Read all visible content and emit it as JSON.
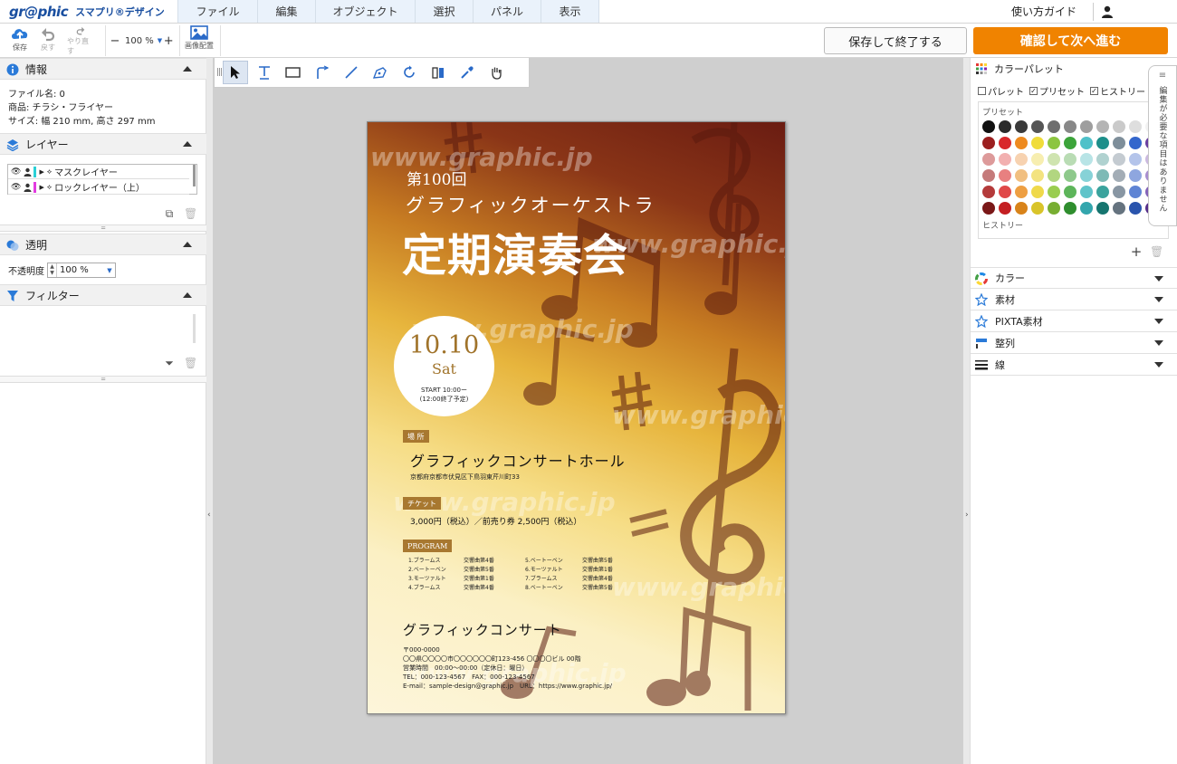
{
  "app": {
    "brand": "gr@phic",
    "app_name": "スマプリ®デザイン"
  },
  "menu": {
    "items": [
      "ファイル",
      "編集",
      "オブジェクト",
      "選択",
      "パネル",
      "表示"
    ],
    "guide": "使い方ガイド"
  },
  "toolbar": {
    "save": "保存",
    "undo": "戻す",
    "redo": "やり直す",
    "zoom_value": "100 %",
    "zoom_minus": "−",
    "zoom_plus": "+",
    "image_place": "画像配置",
    "save_exit": "保存して終了する",
    "confirm_next": "確認して次へ進む"
  },
  "left_panel": {
    "info": {
      "title": "情報",
      "file_name": "ファイル名:  0",
      "product": "商品:  チラシ・フライヤー",
      "size": "サイズ:  幅 210 mm,  高さ 297 mm"
    },
    "layers": {
      "title": "レイヤー",
      "items": [
        {
          "name": "マスクレイヤー",
          "color": "#2bd0d6"
        },
        {
          "name": "ロックレイヤー（上）",
          "color": "#e23be0"
        }
      ]
    },
    "transparency": {
      "title": "透明",
      "label": "不透明度",
      "value": "100 %"
    },
    "filter": {
      "title": "フィルター"
    }
  },
  "flyer": {
    "watermark": "www.graphic.jp",
    "edition": "第100回",
    "subtitle": "グラフィックオーケストラ",
    "title": "定期演奏会",
    "date": "10.10",
    "day": "Sat",
    "start": "START 10:00ー",
    "end_note": "(12:00終了予定)",
    "venue_tag": "場 所",
    "venue": "グラフィックコンサートホール",
    "address": "京都府京都市伏見区下鳥羽東芹川町33",
    "ticket_tag": "チケット",
    "price": "3,000円（税込）／前売り券 2,500円（税込）",
    "program_tag": "PROGRAM",
    "program": [
      [
        "1.ブラームス",
        "交響曲第4番"
      ],
      [
        "2.ベートーベン",
        "交響曲第5番"
      ],
      [
        "3.モーツァルト",
        "交響曲第1番"
      ],
      [
        "4.ブラームス",
        "交響曲第4番"
      ],
      [
        "5.ベートーベン",
        "交響曲第5番"
      ],
      [
        "6.モーツァルト",
        "交響曲第1番"
      ],
      [
        "7.ブラームス",
        "交響曲第4番"
      ],
      [
        "8.ベートーベン",
        "交響曲第5番"
      ]
    ],
    "organizer": "グラフィックコンサート",
    "contact": [
      "〒000-0000",
      "〇〇県〇〇〇〇市〇〇〇〇〇〇町123-456 〇〇〇〇ビル 00階",
      "営業時間　00:00〜00:00（定休日：曜日）",
      "TEL：000-123-4567　FAX：000-123-4567",
      "E-mail：sample-design@graphic.jp　URL：https://www.graphic.jp/"
    ]
  },
  "right_panel": {
    "color_palette": {
      "title": "カラーパレット",
      "checks": [
        {
          "label": "パレット",
          "checked": false
        },
        {
          "label": "プリセット",
          "checked": true
        },
        {
          "label": "ヒストリー",
          "checked": true
        }
      ],
      "preset_label": "プリセット",
      "history_label": "ヒストリー",
      "swatches": [
        "#111111",
        "#2b2b2b",
        "#3a3a3a",
        "#555555",
        "#6e6e6e",
        "#888888",
        "#9e9e9e",
        "#b4b4b4",
        "#cacaca",
        "#dedede",
        "#f2f2f2",
        "#9b1f1f",
        "#d8282b",
        "#ee8a1f",
        "#f0dc3a",
        "#8cc540",
        "#3ca43a",
        "#4fc1c9",
        "#1d8f8a",
        "#7e8e9a",
        "#3366cc",
        "#6a3fa0",
        "#dd9a9a",
        "#f2b0b0",
        "#f7d2b0",
        "#f7eeb0",
        "#cfe4b0",
        "#b9dcb4",
        "#b8e4e6",
        "#b0d2d0",
        "#c4cbd1",
        "#b4c4ea",
        "#cbb9df",
        "#c57a7a",
        "#e88080",
        "#f1bf80",
        "#f3e380",
        "#b2d680",
        "#8ec98b",
        "#86d2d7",
        "#7dbab6",
        "#a3adb6",
        "#8ea6df",
        "#a88ecf",
        "#b43a3a",
        "#e04848",
        "#ee9f42",
        "#efd94a",
        "#9acd50",
        "#5db55a",
        "#5fc4ca",
        "#3aa39d",
        "#8896a3",
        "#5f84d4",
        "#8463b8",
        "#7a1818",
        "#c41f22",
        "#d8831a",
        "#d9c42a",
        "#78ae32",
        "#2f8e2e",
        "#33a6ad",
        "#16756f",
        "#65737f",
        "#2a54ad",
        "#572f8a"
      ],
      "side_tab": "編集が必要な項目はありません"
    },
    "accordions": [
      "カラー",
      "素材",
      "PIXTA素材",
      "整列",
      "線"
    ]
  }
}
